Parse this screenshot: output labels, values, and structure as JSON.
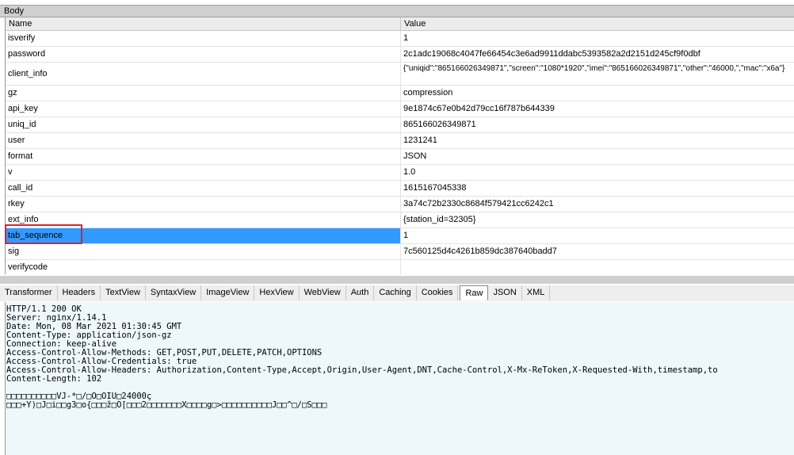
{
  "request": {
    "section_title": "Body",
    "columns": {
      "name": "Name",
      "value": "Value"
    },
    "rows": [
      {
        "name": "isverify",
        "value": "1"
      },
      {
        "name": "password",
        "value": "2c1adc19068c4047fe66454c3e6ad9911ddabc5393582a2d2151d245cf9f0dbf"
      },
      {
        "name": "client_info",
        "value": "{\"uniqid\":\"865166026349871\",\"screen\":\"1080*1920\",\"imei\":\"865166026349871\",\"other\":\"46000,\",\"mac\":\"x6a\"}"
      },
      {
        "name": "gz",
        "value": "compression"
      },
      {
        "name": "api_key",
        "value": "9e1874c67e0b42d79cc16f787b644339"
      },
      {
        "name": "uniq_id",
        "value": "865166026349871"
      },
      {
        "name": "user",
        "value": "1231241"
      },
      {
        "name": "format",
        "value": "JSON"
      },
      {
        "name": "v",
        "value": "1.0"
      },
      {
        "name": "call_id",
        "value": "1615167045338"
      },
      {
        "name": "rkey",
        "value": "3a74c72b2330c8684f579421cc6242c1"
      },
      {
        "name": "ext_info",
        "value": "{station_id=32305}"
      },
      {
        "name": "tab_sequence",
        "value": "1"
      },
      {
        "name": "sig",
        "value": "7c560125d4c4261b859dc387640badd7"
      },
      {
        "name": "verifycode",
        "value": ""
      }
    ],
    "selected_row": "tab_sequence"
  },
  "response": {
    "tabs": [
      "Transformer",
      "Headers",
      "TextView",
      "SyntaxView",
      "ImageView",
      "HexView",
      "WebView",
      "Auth",
      "Caching",
      "Cookies",
      "Raw",
      "JSON",
      "XML"
    ],
    "active_tab": "Raw",
    "raw_lines": [
      "HTTP/1.1 200 OK",
      "Server: nginx/1.14.1",
      "Date: Mon, 08 Mar 2021 01:30:45 GMT",
      "Content-Type: application/json-gz",
      "Connection: keep-alive",
      "Access-Control-Allow-Methods: GET,POST,PUT,DELETE,PATCH,OPTIONS",
      "Access-Control-Allow-Credentials: true",
      "Access-Control-Allow-Headers: Authorization,Content-Type,Accept,Origin,User-Agent,DNT,Cache-Control,X-Mx-ReToken,X-Requested-With,timestamp,to",
      "Content-Length: 102",
      "",
      "□□□□□□□□□□VJ-*□/□O□OIU□24000ç",
      "□□□+Y)□J□i□□g3□o{□□□ž□O[□□□2□□□□□□□X□□□□g□>□□□□□□□□□□J□□^□/□S□□□"
    ]
  },
  "colors": {
    "selection": "#3399ff",
    "highlight_box": "#e0202a",
    "raw_background": "#edf7fc"
  }
}
